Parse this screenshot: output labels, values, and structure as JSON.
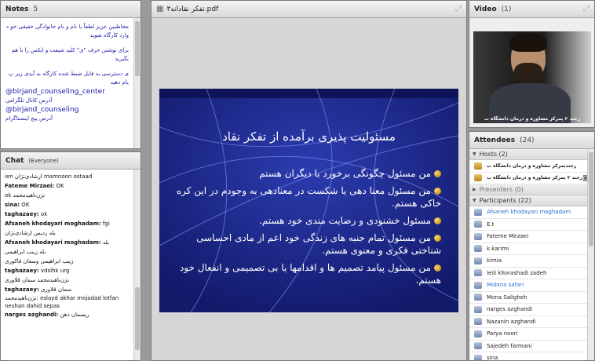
{
  "notes": {
    "title": "Notes",
    "count": "5",
    "lines": [
      "مخاطبین عزیز لطفاً با نام و نام خانوادگی حقیقی خو د وارد کارگاه شوید",
      "برای نوشتن حرف \"ی\" کلید شیفت و ایکس را با هم بگیرید",
      "ی دسترسی به فایل ضبط شده کارگاه به آیدی زیر پ یام دهید"
    ],
    "handle1": "@birjand_counseling_center",
    "handle1_caption": "آدرس کانال تلگرامی",
    "handle2": "@birjand_counseling",
    "handle2_caption": "آدرس پیج اینستاگرام"
  },
  "chat": {
    "title": "Chat",
    "scope": "(Everyone)",
    "messages": [
      {
        "sender": "",
        "text": "ien ارشادی‌تژان mamnoon   ostaad"
      },
      {
        "sender": "Fateme Mirzaei:",
        "text": " OK"
      },
      {
        "sender": "",
        "text": "ok نژن‌ناهیدمحمد"
      },
      {
        "sender": "sina:",
        "text": " OK"
      },
      {
        "sender": "taghazaey:",
        "text": " ok"
      },
      {
        "sender": "Afsaneh khodayari moghadam:",
        "text": " fgi"
      },
      {
        "sender": "",
        "text": "بله ردیس ارشادی‌تژان"
      },
      {
        "sender": "Afsaneh khodayari moghadam:",
        "text": " بله"
      },
      {
        "sender": "",
        "text": "بله زینب ابراهیمی"
      },
      {
        "sender": "",
        "text": "زینب ابراهیمی  وسعان قاکوری"
      },
      {
        "sender": "taghazaey:",
        "text": " vdslhk urg"
      },
      {
        "sender": "",
        "text": "نژن‌ناهیدمحمد  سمان قلاوری"
      },
      {
        "sender": "taghazaey:",
        "text": " سمان قلاوری"
      },
      {
        "sender": "",
        "text": "نژن‌ناهیدمحمد: eslayd akhar mojadad lotfan neshan dahid sepas"
      },
      {
        "sender": "narges azghandi:",
        "text": " ریسمان ذهن"
      }
    ]
  },
  "share": {
    "title": "تفکر نقادانه٣.pdf"
  },
  "slide": {
    "title": "مسئولیت پذیری برآمده از تفکر نقاد",
    "bullets": [
      "من مسئول چگونگی برخورد با دیگران هستم",
      "من مسئول معنا دهی یا شکست در معنادهی به وجودم در این کره خاکی هستم.",
      "مسئول خشنودی و رضایت مندی خود هستم.",
      "من مسئول تمام جنبه های زندگی خود اعم از مادی احساسی شناختی فکری و معنوی هستم.",
      "من مسئول پیامد تصمیم ها و اقدامها یا بی تصمیمی و انفعال خود هستم."
    ]
  },
  "video": {
    "title": "Video",
    "count": "(1)",
    "label": "رجند ٢ پمرکز مشاوره و درمان دانشگاه ب"
  },
  "attendees": {
    "title": "Attendees",
    "count": "(24)",
    "hosts_label": "Hosts (2)",
    "presenters_label": "Presenters (0)",
    "participants_label": "Participants (22)",
    "hosts": [
      "رجندپمرکز مشاوره و درمان دانشگاه ب",
      "رجند ٢ پمرکز مشاوره و درمان دانشگاه ب"
    ],
    "participants": [
      "Afsaneh khodayari moghadam",
      "E.t",
      "Fateme Mirzaei",
      "k.karimi",
      "kimia",
      "leili khorashadi zadeh",
      "Mobina safari",
      "Mona Saligheh",
      "narges azghandi",
      "Nazanin azghandi",
      "Parya noori",
      "Sajedeh farmani",
      "sina"
    ]
  },
  "colors": {
    "slide_bg": "#1e2a8c",
    "link_blue": "#1a1aa8",
    "highlight_blue": "#2a6fd0"
  }
}
